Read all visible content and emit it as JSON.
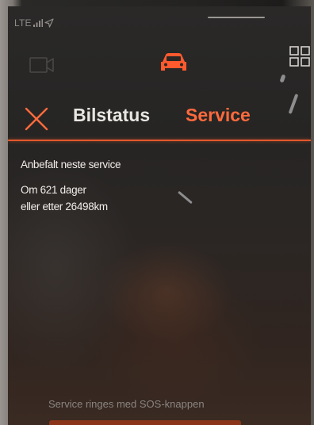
{
  "status_bar": {
    "network": "LTE"
  },
  "toolbar": {
    "left_icon": "camera-icon",
    "center_icon": "car-icon",
    "right_icon": "grid-icon",
    "active_color": "#ff5a2e"
  },
  "header": {
    "close_icon": "close-icon",
    "tabs": [
      {
        "label": "Bilstatus",
        "active": false
      },
      {
        "label": "Service",
        "active": true
      }
    ],
    "accent_color": "#e3582b"
  },
  "service_info": {
    "heading": "Anbefalt neste service",
    "days_line": "Om 621 dager",
    "km_line": "eller etter 26498km"
  },
  "footer": {
    "sos_note": "Service ringes med SOS-knappen"
  }
}
